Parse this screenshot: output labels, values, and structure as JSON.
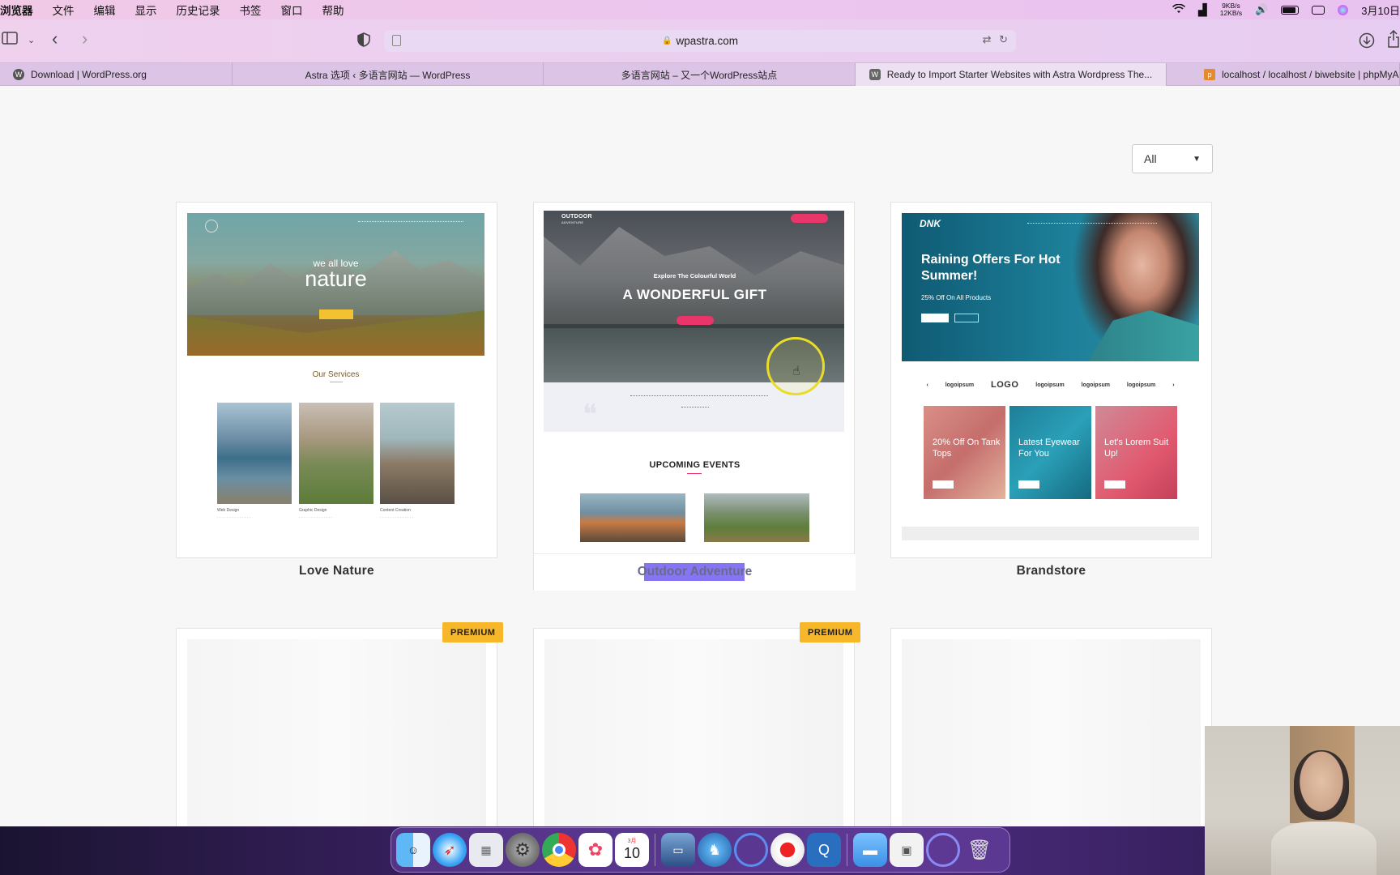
{
  "menubar": {
    "items": [
      "浏览器",
      "文件",
      "编辑",
      "显示",
      "历史记录",
      "书签",
      "窗口",
      "帮助"
    ],
    "netspeed_up": "9KB/s",
    "netspeed_down": "12KB/s",
    "date": "3月10日"
  },
  "toolbar": {
    "url": "wpastra.com"
  },
  "tabs": [
    {
      "label": "Download | WordPress.org",
      "favicon": "wordpress-icon"
    },
    {
      "label": "Astra 选项 ‹ 多语言网站 — WordPress",
      "favicon": ""
    },
    {
      "label": "多语言网站 – 又一个WordPress站点",
      "favicon": ""
    },
    {
      "label": "Ready to Import Starter Websites with Astra Wordpress The...",
      "favicon": "w-icon"
    },
    {
      "label": "localhost / localhost / biwebsite | phpMyAd",
      "favicon": "pma-icon"
    }
  ],
  "filter": {
    "value": "All"
  },
  "cards": [
    {
      "title": "Love Nature",
      "preview": {
        "hero_small": "we all love",
        "hero_big": "nature",
        "section": "Our Services",
        "services": [
          "Web Design",
          "Graphic Design",
          "Content Creation"
        ]
      }
    },
    {
      "title": "Outdoor Adventure",
      "preview": {
        "logo_line1": "OUTDOOR",
        "logo_line2": "ADVENTURE",
        "hero_sub": "Explore The Colourful World",
        "hero_title": "A WONDERFUL GIFT",
        "events": "UPCOMING EVENTS"
      }
    },
    {
      "title": "Brandstore",
      "preview": {
        "logo": "DNK",
        "hero_title": "Raining Offers For Hot Summer!",
        "hero_sub": "25% Off On All Products",
        "brand_logos": [
          "logoipsum",
          "LOGO",
          "logoipsum",
          "logoipsum",
          "logoipsum"
        ],
        "tiles": [
          "20% Off On Tank Tops",
          "Latest Eyewear For You",
          "Let's Lorem Suit Up!"
        ]
      }
    }
  ],
  "badges": {
    "premium": "PREMIUM"
  },
  "dock": {
    "calendar_month": "3月",
    "calendar_day": "10"
  }
}
